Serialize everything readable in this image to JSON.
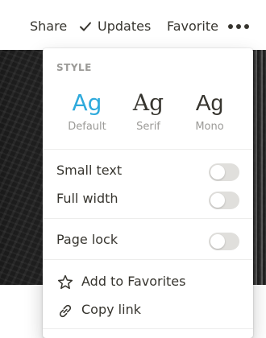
{
  "topbar": {
    "share_label": "Share",
    "updates_label": "Updates",
    "favorite_label": "Favorite",
    "more_icon": "ellipsis-icon"
  },
  "menu": {
    "style_section": {
      "label": "STYLE",
      "options": [
        {
          "sample": "Ag",
          "caption": "Default",
          "selected": true,
          "color": "#2eaadc"
        },
        {
          "sample": "Ag",
          "caption": "Serif",
          "selected": false
        },
        {
          "sample": "Ag",
          "caption": "Mono",
          "selected": false
        }
      ]
    },
    "toggles": [
      {
        "label": "Small text",
        "on": false
      },
      {
        "label": "Full width",
        "on": false
      },
      {
        "label": "Page lock",
        "on": false
      }
    ],
    "actions": [
      {
        "label": "Add to Favorites",
        "icon": "star-icon"
      },
      {
        "label": "Copy link",
        "icon": "link-icon"
      }
    ]
  },
  "colors": {
    "accent": "#2eaadc",
    "text": "#37352f",
    "muted": "#9b9a97",
    "toggle_off": "#e0dfdc"
  }
}
